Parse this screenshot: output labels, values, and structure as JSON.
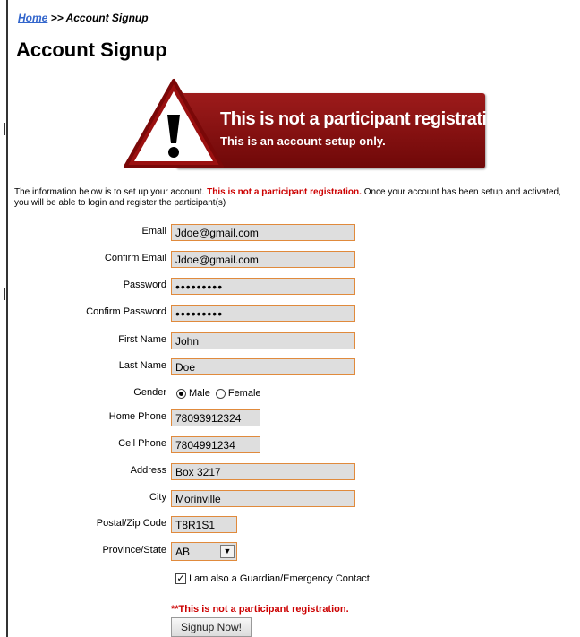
{
  "breadcrumb": {
    "home": "Home",
    "separator": ">>",
    "current": "Account Signup"
  },
  "page_title": "Account Signup",
  "banner": {
    "line1": "This is not a participant registration.",
    "line2": "This is an account setup only.",
    "colors": {
      "box": "#8b1212",
      "text": "#ffffff",
      "triangle": "#c41e1e"
    }
  },
  "intro": {
    "part1": "The information below is to set up your account. ",
    "red": "This is not a participant registration.",
    "part2": " Once your account has been setup and activated, you will be able to login and register the participant(s)"
  },
  "form": {
    "email_label": "Email",
    "email_value": "Jdoe@gmail.com",
    "confirm_email_label": "Confirm Email",
    "confirm_email_value": "Jdoe@gmail.com",
    "password_label": "Password",
    "password_value": "•••••••••",
    "confirm_password_label": "Confirm Password",
    "confirm_password_value": "•••••••••",
    "first_name_label": "First Name",
    "first_name_value": "John",
    "last_name_label": "Last Name",
    "last_name_value": "Doe",
    "gender_label": "Gender",
    "gender_male": "Male",
    "gender_female": "Female",
    "gender_selected": "Male",
    "home_phone_label": "Home Phone",
    "home_phone_value": "78093912324",
    "cell_phone_label": "Cell Phone",
    "cell_phone_value": "7804991234",
    "address_label": "Address",
    "address_value": "Box 3217",
    "city_label": "City",
    "city_value": "Morinville",
    "postal_label": "Postal/Zip Code",
    "postal_value": "T8R1S1",
    "province_label": "Province/State",
    "province_value": "AB",
    "guardian_label": "I am also a Guardian/Emergency Contact",
    "guardian_checked": true,
    "bottom_warning": "**This is not a participant registration.",
    "submit_label": "Signup Now!"
  },
  "colors": {
    "field_border": "#e08a3c",
    "field_bg": "#dedede",
    "link": "#3366cc",
    "warning": "#cc0000"
  }
}
